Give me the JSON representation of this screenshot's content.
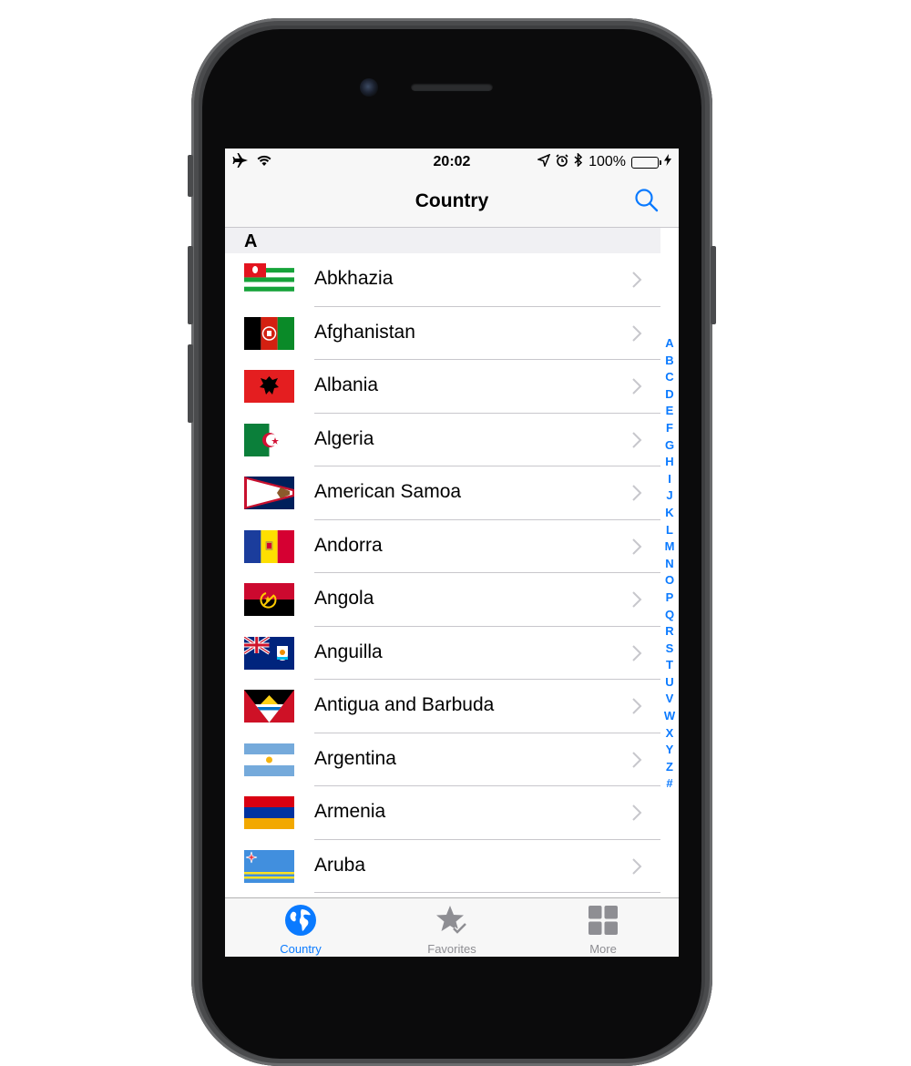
{
  "status_bar": {
    "time": "20:02",
    "battery": "100%"
  },
  "nav": {
    "title": "Country"
  },
  "section": "A",
  "countries": [
    {
      "name": "Abkhazia",
      "flag": "abkhazia-flag"
    },
    {
      "name": "Afghanistan",
      "flag": "afghanistan-flag"
    },
    {
      "name": "Albania",
      "flag": "albania-flag"
    },
    {
      "name": "Algeria",
      "flag": "algeria-flag"
    },
    {
      "name": "American Samoa",
      "flag": "american-samoa-flag"
    },
    {
      "name": "Andorra",
      "flag": "andorra-flag"
    },
    {
      "name": "Angola",
      "flag": "angola-flag"
    },
    {
      "name": "Anguilla",
      "flag": "anguilla-flag"
    },
    {
      "name": "Antigua and Barbuda",
      "flag": "antigua-and-barbuda-flag"
    },
    {
      "name": "Argentina",
      "flag": "argentina-flag"
    },
    {
      "name": "Armenia",
      "flag": "armenia-flag"
    },
    {
      "name": "Aruba",
      "flag": "aruba-flag"
    }
  ],
  "index": [
    "A",
    "B",
    "C",
    "D",
    "E",
    "F",
    "G",
    "H",
    "I",
    "J",
    "K",
    "L",
    "M",
    "N",
    "O",
    "P",
    "Q",
    "R",
    "S",
    "T",
    "U",
    "V",
    "W",
    "X",
    "Y",
    "Z",
    "#"
  ],
  "tabs": [
    {
      "label": "Country",
      "icon": "globe-icon",
      "active": true
    },
    {
      "label": "Favorites",
      "icon": "star-check-icon",
      "active": false
    },
    {
      "label": "More",
      "icon": "grid-icon",
      "active": false
    }
  ],
  "colors": {
    "accent": "#0a7aff",
    "inactive": "#8e8e93",
    "separator": "#c8c7cc"
  }
}
